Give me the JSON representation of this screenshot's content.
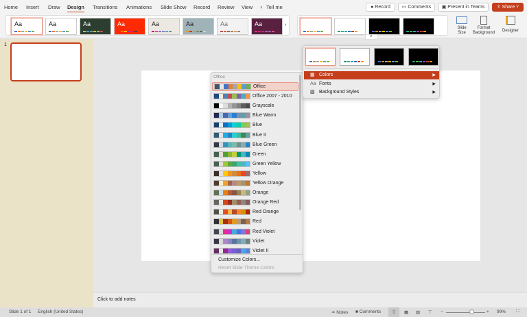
{
  "tabs": [
    "Home",
    "Insert",
    "Draw",
    "Design",
    "Transitions",
    "Animations",
    "Slide Show",
    "Record",
    "Review",
    "View",
    "Tell me"
  ],
  "active_tab": "Design",
  "top_buttons": {
    "record": "Record",
    "comments": "Comments",
    "teams": "Present in Teams",
    "share": "Share"
  },
  "themes": [
    {
      "aa": "Aa",
      "bg": "#ffffff",
      "fg": "#222",
      "colors": [
        "#4472c4",
        "#ed7d31",
        "#a5a5a5",
        "#ffc000",
        "#5b9bd5",
        "#70ad47"
      ]
    },
    {
      "aa": "Aa",
      "bg": "#ffffff",
      "fg": "#222",
      "colors": [
        "#4472c4",
        "#ed7d31",
        "#a5a5a5",
        "#ffc000",
        "#5b9bd5",
        "#70ad47"
      ]
    },
    {
      "aa": "Aa",
      "bg": "#2c3e30",
      "fg": "#fff",
      "colors": [
        "#a5c76f",
        "#56a0c5",
        "#6ba084",
        "#e0b044",
        "#8ac06a",
        "#c0504d"
      ]
    },
    {
      "aa": "Aa",
      "bg": "#ff2a00",
      "fg": "#fff",
      "colors": [
        "#ff2a00",
        "#ff7b00",
        "#ffbb00",
        "#9c2bd6",
        "#d61e6a",
        "#444"
      ]
    },
    {
      "aa": "Aa",
      "bg": "#ece8e2",
      "fg": "#222",
      "colors": [
        "#c0255a",
        "#d7578d",
        "#9a6ec5",
        "#7d88c9",
        "#59a5cb",
        "#6f8e9a"
      ]
    },
    {
      "aa": "Aa",
      "bg": "#9fb3b8",
      "fg": "#222",
      "colors": [
        "#f39c12",
        "#c0392b",
        "#b5a47a",
        "#8a8f6a",
        "#5a6e73",
        "#d0d0d0"
      ]
    },
    {
      "aa": "Aa",
      "bg": "#f2f2f2",
      "fg": "#777",
      "colors": [
        "#c0504d",
        "#d65e3c",
        "#8a6e58",
        "#a08060",
        "#d9a066",
        "#888"
      ]
    },
    {
      "aa": "Aa",
      "bg": "#5a2040",
      "fg": "#fff",
      "colors": [
        "#e0307a",
        "#c02a6a",
        "#a03090",
        "#c05098",
        "#9060a0",
        "#e05080"
      ]
    }
  ],
  "variants": [
    {
      "bg": "#ffffff",
      "colors": [
        "#4472c4",
        "#ed7d31",
        "#a5a5a5",
        "#ffc000",
        "#5b9bd5",
        "#70ad47"
      ]
    },
    {
      "bg": "#ffffff",
      "colors": [
        "#1e9c8a",
        "#4caf50",
        "#29a3c7",
        "#3b6fb6",
        "#c0392b",
        "#f39c12"
      ]
    },
    {
      "bg": "#000000",
      "colors": [
        "#4472c4",
        "#ed7d31",
        "#a5a5a5",
        "#ffc000",
        "#5b9bd5",
        "#70ad47"
      ]
    },
    {
      "bg": "#000000",
      "colors": [
        "#1e9c8a",
        "#4caf50",
        "#29a3c7",
        "#7c4dbb",
        "#c0392b",
        "#f39c12"
      ]
    }
  ],
  "ribbon": {
    "slide_size": "Slide Size",
    "format_background": "Format Background",
    "designer": "Designer"
  },
  "variant_menu": {
    "colors": "Colors",
    "fonts": "Fonts",
    "background_styles": "Background Styles"
  },
  "colors_menu": {
    "header": "Office",
    "selected": "Office",
    "items": [
      {
        "name": "Office",
        "sw": [
          "#44546a",
          "#e7e6e6",
          "#4472c4",
          "#ed7d31",
          "#a5a5a5",
          "#ffc000",
          "#5b9bd5",
          "#70ad47"
        ]
      },
      {
        "name": "Office 2007 - 2010",
        "sw": [
          "#1f497d",
          "#eeece1",
          "#4f81bd",
          "#c0504d",
          "#9bbb59",
          "#8064a2",
          "#4bacc6",
          "#f79646"
        ]
      },
      {
        "name": "Grayscale",
        "sw": [
          "#000000",
          "#f8f8f8",
          "#dddddd",
          "#b2b2b2",
          "#969696",
          "#808080",
          "#5f5f5f",
          "#4d4d4d"
        ]
      },
      {
        "name": "Blue Warm",
        "sw": [
          "#242852",
          "#acccea",
          "#4a66ac",
          "#629dd1",
          "#297fd5",
          "#7f8fa9",
          "#5aa2ae",
          "#9d90a0"
        ]
      },
      {
        "name": "Blue",
        "sw": [
          "#17406d",
          "#dbeff9",
          "#0f6fc6",
          "#009dd9",
          "#0bd0d9",
          "#10cf9b",
          "#7cca62",
          "#a5c249"
        ]
      },
      {
        "name": "Blue II",
        "sw": [
          "#335b74",
          "#dfe3e5",
          "#1cade4",
          "#2683c6",
          "#27ced7",
          "#42ba97",
          "#3e8853",
          "#62a39f"
        ]
      },
      {
        "name": "Blue Green",
        "sw": [
          "#373545",
          "#cedbe6",
          "#3494ba",
          "#58b6c0",
          "#75bda7",
          "#7a8c8e",
          "#84acb6",
          "#2683c6"
        ]
      },
      {
        "name": "Green",
        "sw": [
          "#455f51",
          "#e3ded1",
          "#549e39",
          "#8ab833",
          "#c0cf3a",
          "#029676",
          "#4ab5c4",
          "#0989b1"
        ]
      },
      {
        "name": "Green Yellow",
        "sw": [
          "#455f51",
          "#e3ded1",
          "#99cb38",
          "#63a537",
          "#37a76f",
          "#44c1a3",
          "#4eb3cf",
          "#51c3f9"
        ]
      },
      {
        "name": "Yellow",
        "sw": [
          "#39302a",
          "#e5dedb",
          "#ffca08",
          "#f8931d",
          "#ce8d3e",
          "#ec7016",
          "#e64823",
          "#9c6a6a"
        ]
      },
      {
        "name": "Yellow Orange",
        "sw": [
          "#4e3b30",
          "#fbeec9",
          "#f0a22e",
          "#a5644e",
          "#b58b80",
          "#c3986d",
          "#a19574",
          "#c17529"
        ]
      },
      {
        "name": "Orange",
        "sw": [
          "#637052",
          "#ccddea",
          "#e48312",
          "#bd582c",
          "#865640",
          "#9b8357",
          "#c2bc80",
          "#94a088"
        ]
      },
      {
        "name": "Orange Red",
        "sw": [
          "#696464",
          "#e9e5dc",
          "#d34817",
          "#9b2d1f",
          "#a28e6a",
          "#956251",
          "#918485",
          "#855d5d"
        ]
      },
      {
        "name": "Red Orange",
        "sw": [
          "#505046",
          "#eeece1",
          "#e84c22",
          "#ffbd47",
          "#b64926",
          "#ff8427",
          "#cc9900",
          "#b22600"
        ]
      },
      {
        "name": "Red",
        "sw": [
          "#323232",
          "#e5c243",
          "#a5300f",
          "#d55816",
          "#e19825",
          "#b19c7d",
          "#7f5f52",
          "#b27d49"
        ]
      },
      {
        "name": "Red Violet",
        "sw": [
          "#454551",
          "#d8d9dc",
          "#e32d91",
          "#c830cc",
          "#4ea6dc",
          "#4775e7",
          "#8971e1",
          "#d54773"
        ]
      },
      {
        "name": "Violet",
        "sw": [
          "#373545",
          "#dcd8dc",
          "#ad84c6",
          "#8784c7",
          "#5d739a",
          "#6997af",
          "#84acb6",
          "#6f8183"
        ]
      },
      {
        "name": "Violet II",
        "sw": [
          "#632e62",
          "#eae5eb",
          "#92278f",
          "#9b57d3",
          "#755dd9",
          "#665eb8",
          "#45a5ed",
          "#5982db"
        ]
      }
    ],
    "customize": "Customize Colors...",
    "reset": "Reset Slide Theme Colors"
  },
  "slide_number": "1",
  "notes_placeholder": "Click to add notes",
  "status": {
    "slide": "Slide 1 of 1",
    "language": "English (United States)",
    "notes": "Notes",
    "comments": "Comments",
    "zoom": "99%"
  },
  "zoom_level_percent": 99
}
